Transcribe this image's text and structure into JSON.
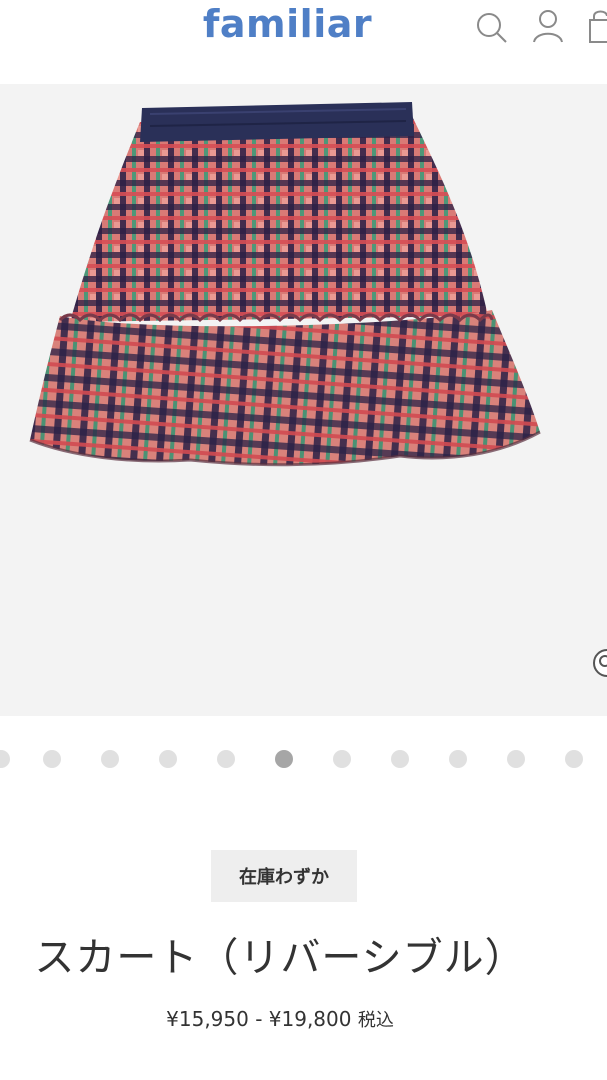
{
  "header": {
    "logo": "familiar",
    "icons": [
      "search-icon",
      "account-icon",
      "cart-icon"
    ]
  },
  "gallery": {
    "image": "reversible-gingham-ruffle-skirt",
    "dot_count": 11,
    "active_index": 5
  },
  "product": {
    "stock_badge": "在庫わずか",
    "name": "スカート（リバーシブル）",
    "price": "¥15,950 - ¥19,800",
    "tax_label": "税込"
  },
  "colors": {
    "brand": "#4f7fc6",
    "gallery_bg": "#f3f3f3",
    "text": "#333333",
    "badge_bg": "#eeeeee"
  }
}
